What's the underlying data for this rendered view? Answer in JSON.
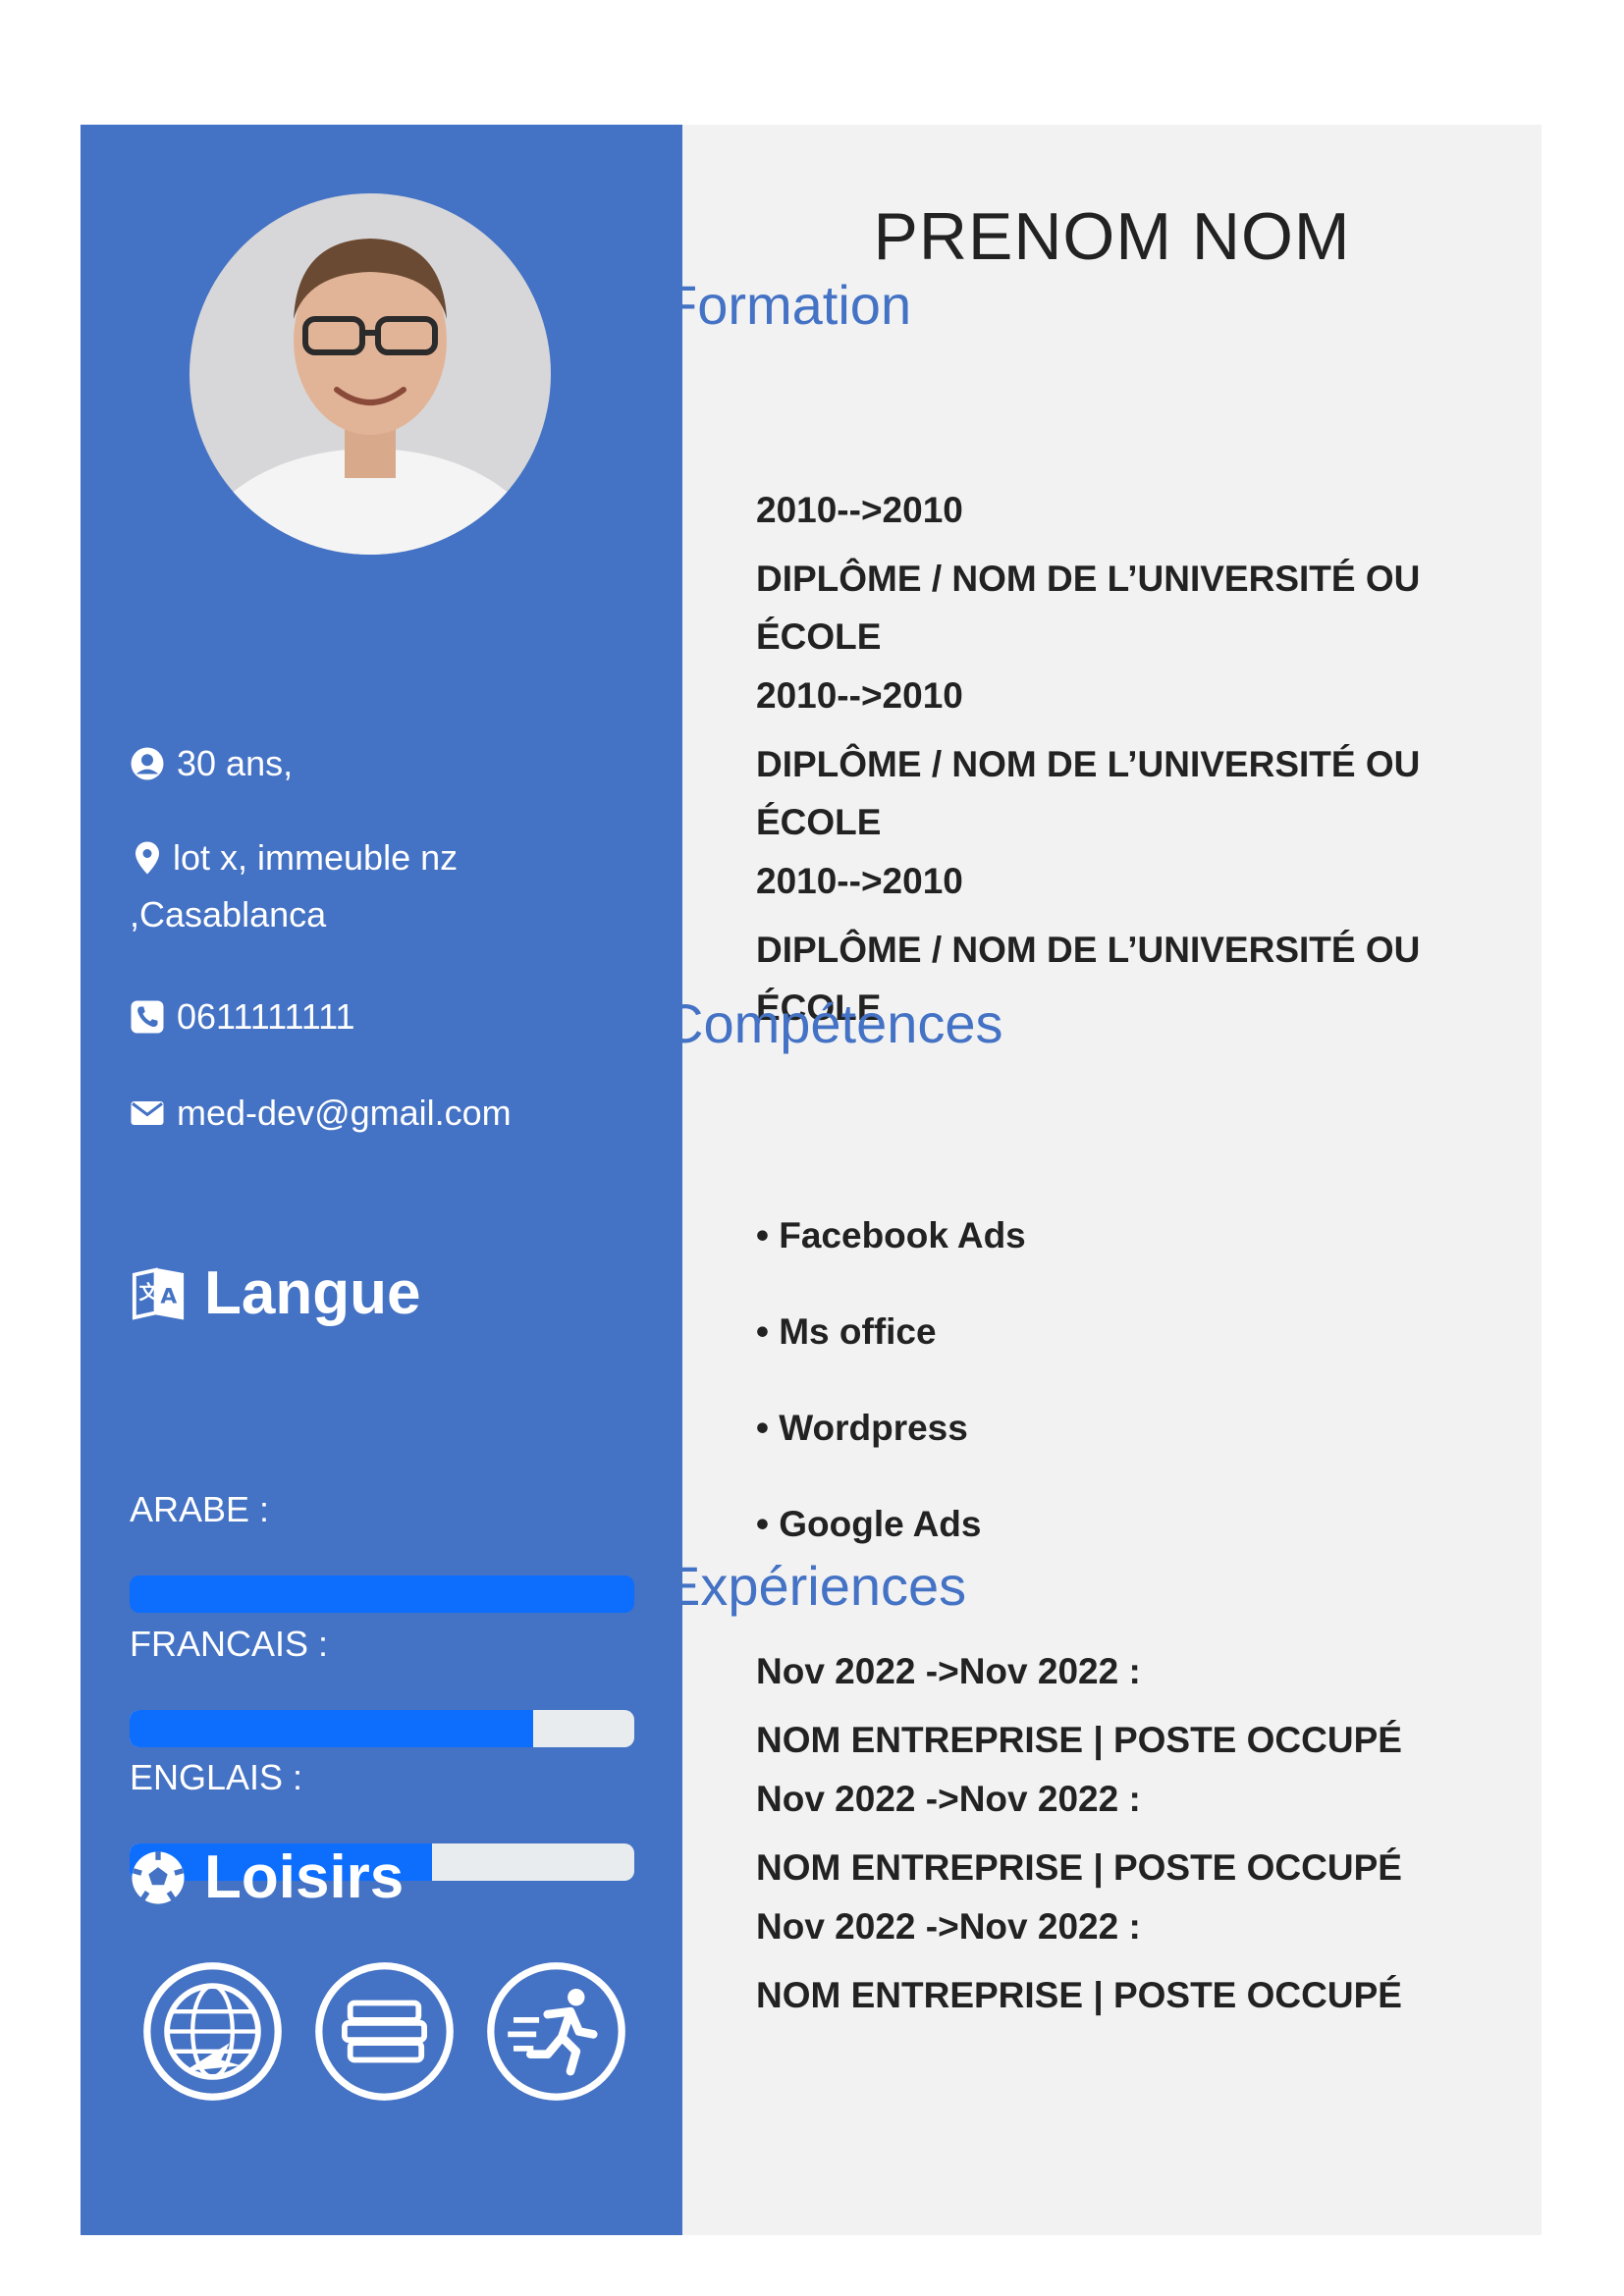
{
  "header": {
    "name": "PRENOM NOM"
  },
  "contact": {
    "age": "30 ans,",
    "address_line1": "lot x, immeuble nz",
    "address_line2": ",Casablanca",
    "phone": "0611111111",
    "email": "med-dev@gmail.com"
  },
  "langue": {
    "title": "Langue",
    "items": [
      {
        "label": "ARABE :",
        "level_percent": 100
      },
      {
        "label": "FRANCAIS :",
        "level_percent": 80
      },
      {
        "label": "ENGLAIS :",
        "level_percent": 60
      }
    ]
  },
  "loisirs": {
    "title": "Loisirs",
    "icons": [
      "globe-icon",
      "books-icon",
      "running-icon"
    ]
  },
  "formation": {
    "title": "Formation",
    "entries": [
      {
        "dates": "2010-->2010",
        "diploma": "DIPLÔME / NOM DE L’UNIVERSITÉ OU ÉCOLE"
      },
      {
        "dates": "2010-->2010",
        "diploma": "DIPLÔME / NOM DE L’UNIVERSITÉ OU ÉCOLE"
      },
      {
        "dates": "2010-->2010",
        "diploma": "DIPLÔME / NOM DE L’UNIVERSITÉ OU ÉCOLE"
      }
    ]
  },
  "competences": {
    "title": "Compétences",
    "items": [
      "• Facebook Ads",
      "• Ms office",
      "• Wordpress",
      "• Google Ads"
    ]
  },
  "experiences": {
    "title": "Expériences",
    "entries": [
      {
        "dates": "Nov 2022 ->Nov 2022 :",
        "company": "NOM ENTREPRISE | POSTE OCCUPÉ"
      },
      {
        "dates": "Nov 2022 ->Nov 2022 :",
        "company": "NOM ENTREPRISE | POSTE OCCUPÉ"
      },
      {
        "dates": "Nov 2022 ->Nov 2022 :",
        "company": "NOM ENTREPRISE | POSTE OCCUPÉ"
      }
    ]
  },
  "colors": {
    "sidebar": "#4472c4",
    "main_bg": "#f2f2f3",
    "accent": "#4472c4",
    "bar_fill": "#0d6efd",
    "bar_track": "#e9ecef"
  }
}
